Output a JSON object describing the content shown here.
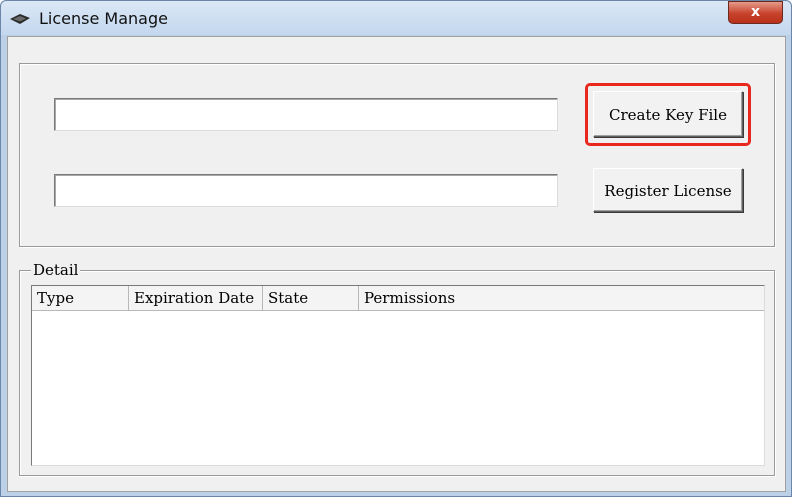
{
  "window": {
    "title": "License Manage",
    "close_label": "x"
  },
  "form": {
    "key_field_value": "",
    "license_field_value": "",
    "create_key_file_label": "Create Key File",
    "register_license_label": "Register License",
    "highlight_color": "#e8281e"
  },
  "detail": {
    "group_label": "Detail",
    "columns": [
      "Type",
      "Expiration Date",
      "State",
      "Permissions"
    ],
    "rows": []
  },
  "icons": {
    "app": "license-card-icon",
    "close": "close-icon"
  }
}
